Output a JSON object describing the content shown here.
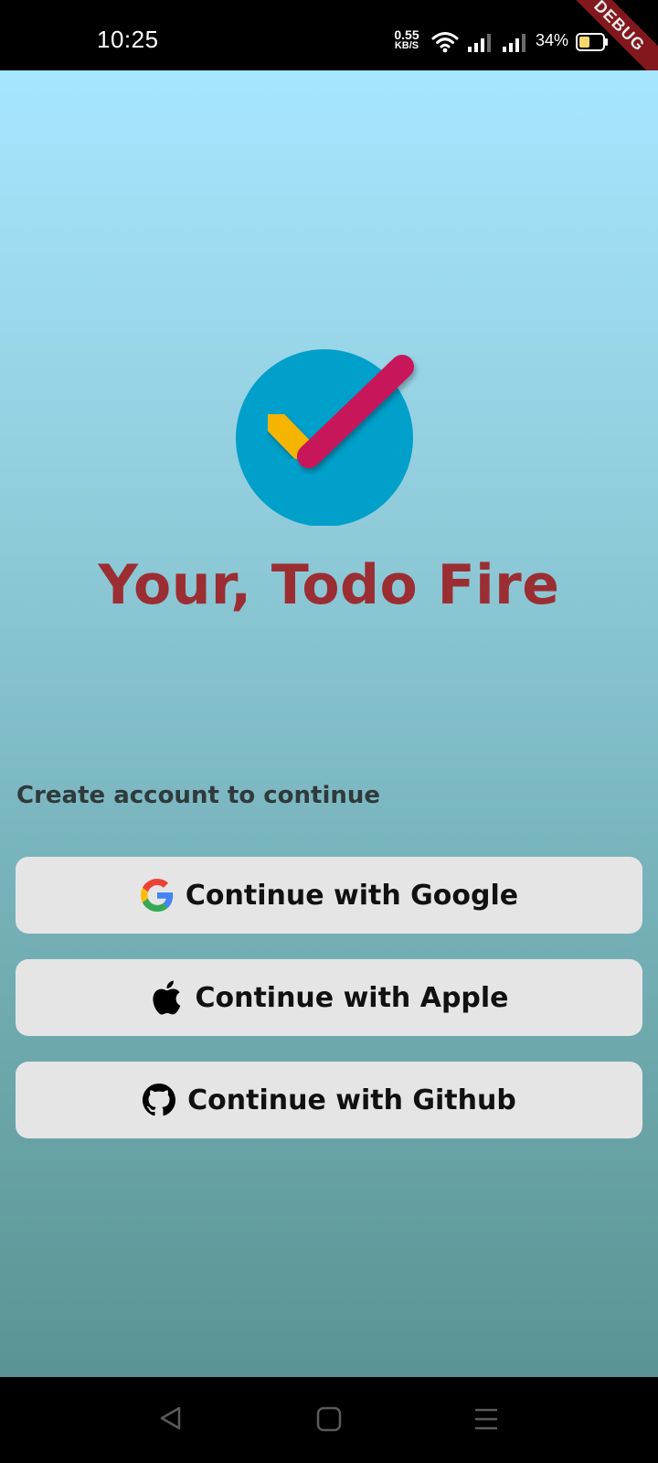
{
  "status_bar": {
    "time": "10:25",
    "net_speed_value": "0.55",
    "net_speed_unit": "KB/S",
    "battery_percent": "34%",
    "icons": [
      "wifi-icon",
      "signal-icon",
      "signal-icon",
      "battery-icon"
    ]
  },
  "debug_banner": "DEBUG",
  "app": {
    "title": "Your, Todo Fire",
    "subtitle": "Create account to continue",
    "buttons": [
      {
        "label": "Continue with Google",
        "icon": "google-icon"
      },
      {
        "label": "Continue with Apple",
        "icon": "apple-icon"
      },
      {
        "label": "Continue with Github",
        "icon": "github-icon"
      }
    ],
    "colors": {
      "title": "#9b2e33",
      "logo_circle": "#00a0cb",
      "check_short": "#f5b400",
      "check_long": "#c8145a",
      "button_bg": "#e6e5e6"
    }
  },
  "nav_bar": {
    "icons": [
      "back-icon",
      "home-icon",
      "recents-icon"
    ]
  }
}
